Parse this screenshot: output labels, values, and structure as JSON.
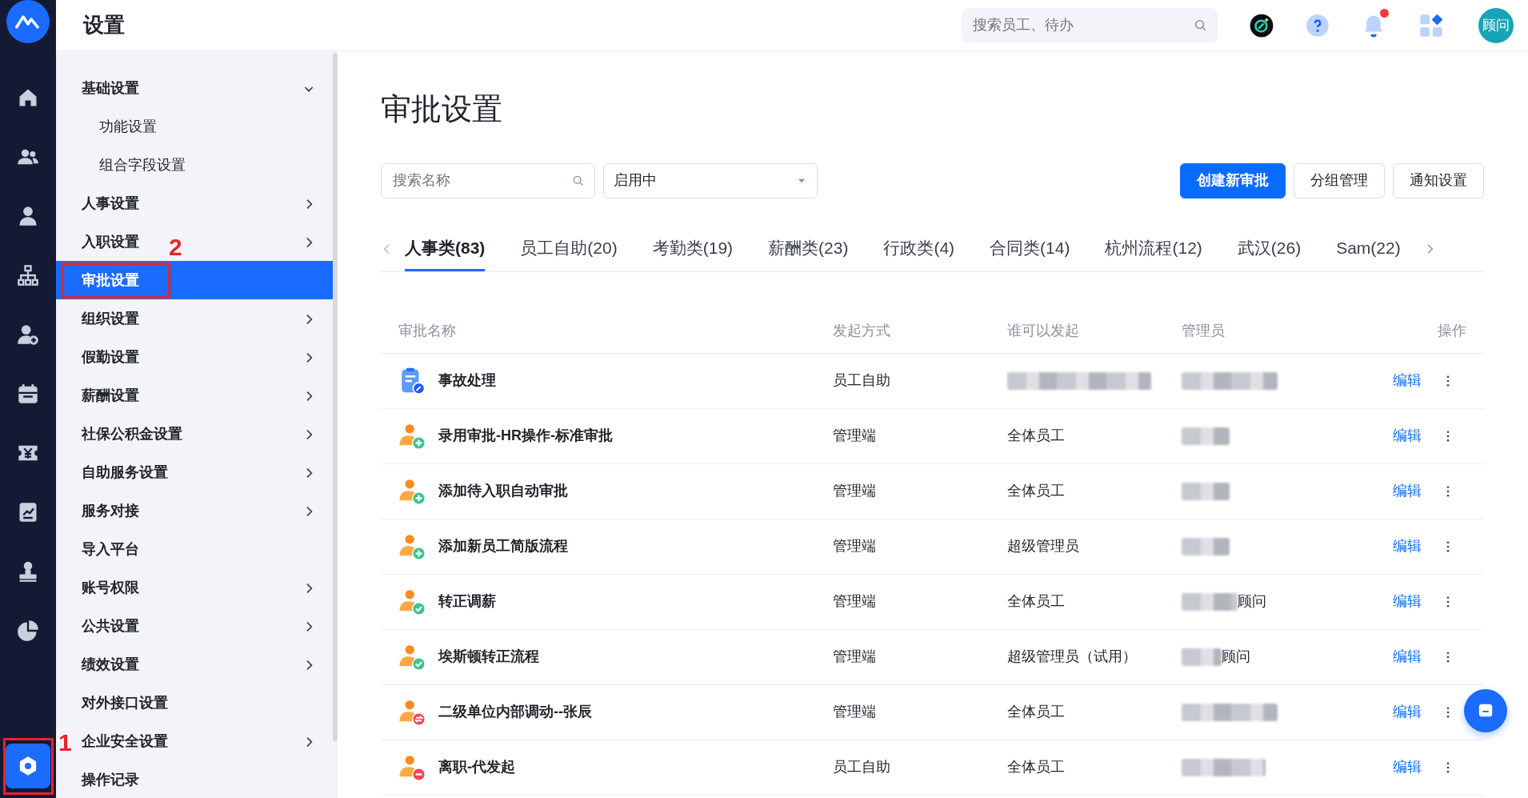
{
  "rail": [
    {
      "kind": "home",
      "selected": false
    },
    {
      "kind": "team",
      "selected": false
    },
    {
      "kind": "person",
      "selected": false
    },
    {
      "kind": "org",
      "selected": false
    },
    {
      "kind": "person-add",
      "selected": false
    },
    {
      "kind": "calendar",
      "selected": false
    },
    {
      "kind": "money",
      "selected": false
    },
    {
      "kind": "chart",
      "selected": false
    },
    {
      "kind": "stamp",
      "selected": false
    },
    {
      "kind": "pie",
      "selected": false
    },
    {
      "kind": "settings",
      "selected": true,
      "annotation": "1"
    }
  ],
  "header": {
    "title": "设置",
    "search": {
      "placeholder": "搜索员工、待办"
    },
    "notification_dot": true,
    "avatar": "顾问"
  },
  "sidebar": {
    "items": [
      {
        "label": "基础设置",
        "selected": false,
        "expanded": true,
        "children": [
          {
            "label": "功能设置",
            "selected": false
          },
          {
            "label": "组合字段设置",
            "selected": false
          }
        ]
      },
      {
        "label": "人事设置",
        "selected": false,
        "expanded": false
      },
      {
        "label": "入职设置",
        "selected": false,
        "expanded": false
      },
      {
        "label": "审批设置",
        "selected": true,
        "annotation": "2"
      },
      {
        "label": "组织设置",
        "selected": false,
        "expanded": false
      },
      {
        "label": "假勤设置",
        "selected": false,
        "expanded": false
      },
      {
        "label": "薪酬设置",
        "selected": false,
        "expanded": false
      },
      {
        "label": "社保公积金设置",
        "selected": false,
        "expanded": false
      },
      {
        "label": "自助服务设置",
        "selected": false,
        "expanded": false
      },
      {
        "label": "服务对接",
        "selected": false,
        "expanded": false
      },
      {
        "label": "导入平台",
        "selected": false
      },
      {
        "label": "账号权限",
        "selected": false,
        "expanded": false
      },
      {
        "label": "公共设置",
        "selected": false,
        "expanded": false
      },
      {
        "label": "绩效设置",
        "selected": false,
        "expanded": false
      },
      {
        "label": "对外接口设置",
        "selected": false
      },
      {
        "label": "企业安全设置",
        "selected": false,
        "expanded": false
      },
      {
        "label": "操作记录",
        "selected": false
      }
    ]
  },
  "page_title": "审批设置",
  "toolbar": {
    "search": {
      "placeholder": "搜索名称"
    },
    "status_select": "启用中",
    "buttons": [
      {
        "label": "创建新审批",
        "kind": "primary"
      },
      {
        "label": "分组管理",
        "kind": "default"
      },
      {
        "label": "通知设置",
        "kind": "default"
      }
    ]
  },
  "tabs": [
    {
      "label": "人事类(83)",
      "selected": true
    },
    {
      "label": "员工自助(20)",
      "selected": false
    },
    {
      "label": "考勤类(19)",
      "selected": false
    },
    {
      "label": "薪酬类(23)",
      "selected": false
    },
    {
      "label": "行政类(4)",
      "selected": false
    },
    {
      "label": "合同类(14)",
      "selected": false
    },
    {
      "label": "杭州流程(12)",
      "selected": false
    },
    {
      "label": "武汉(26)",
      "selected": false
    },
    {
      "label": "Sam(22)",
      "selected": false
    }
  ],
  "table": {
    "columns": [
      "审批名称",
      "发起方式",
      "谁可以发起",
      "管理员",
      "操作"
    ],
    "rows": [
      {
        "kind": "form",
        "name": "事故处理",
        "method": "员工自助",
        "initiator_blurred": true,
        "action": "编辑"
      },
      {
        "kind": "person-add",
        "name": "录用审批-HR操作-标准审批",
        "method": "管理端",
        "initiator": "全体员工",
        "action": "编辑"
      },
      {
        "kind": "person-add",
        "name": "添加待入职自动审批",
        "method": "管理端",
        "initiator": "全体员工",
        "action": "编辑"
      },
      {
        "kind": "person-add",
        "name": "添加新员工简版流程",
        "method": "管理端",
        "initiator": "超级管理员",
        "action": "编辑"
      },
      {
        "kind": "person-check",
        "name": "转正调薪",
        "method": "管理端",
        "initiator": "全体员工",
        "admin_suffix": "顾问",
        "action": "编辑"
      },
      {
        "kind": "person-check",
        "name": "埃斯顿转正流程",
        "method": "管理端",
        "initiator": "超级管理员（试用）",
        "admin_suffix": "顾问",
        "action": "编辑"
      },
      {
        "kind": "person-transfer",
        "name": "二级单位内部调动--张辰",
        "method": "管理端",
        "initiator": "全体员工",
        "action": "编辑"
      },
      {
        "kind": "person-remove",
        "name": "离职-代发起",
        "method": "员工自助",
        "initiator": "全体员工",
        "action": "编辑"
      }
    ]
  }
}
